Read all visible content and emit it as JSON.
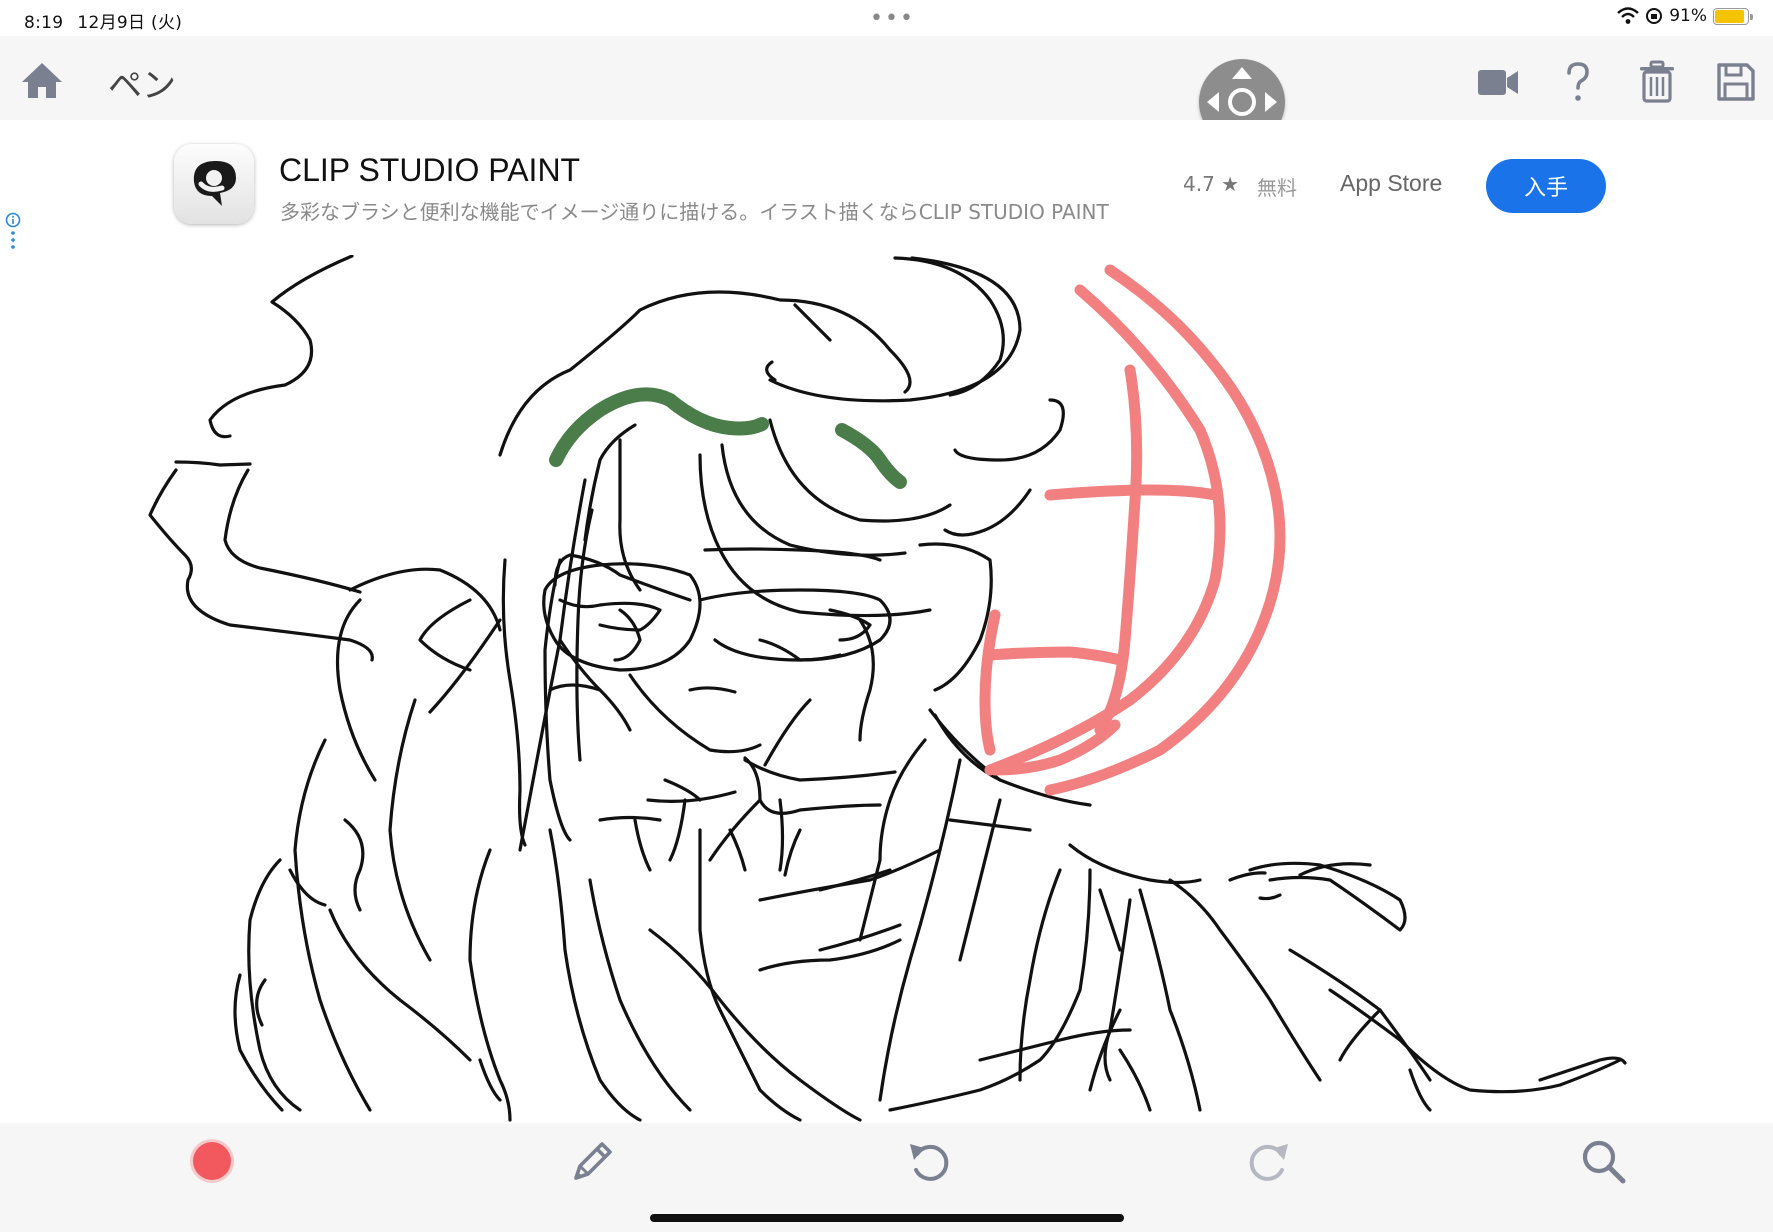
{
  "status": {
    "time": "8:19",
    "date": "12月9日 (火)",
    "multitask": "•••",
    "battery_percent": "91%",
    "battery_level": 0.91
  },
  "toolbar": {
    "title": "ペン",
    "icons": [
      "home-icon",
      "dpad-icon",
      "video-camera-icon",
      "help-icon",
      "trash-icon",
      "save-icon"
    ]
  },
  "ad": {
    "app_name": "CLIP STUDIO PAINT",
    "description": "多彩なブラシと便利な機能でイメージ通りに描ける。イラスト描くならCLIP STUDIO PAINT",
    "rating": "4.7 ★",
    "price": "無料",
    "store": "App Store",
    "get_label": "入手"
  },
  "canvas": {
    "stroke_colors": {
      "ink": "#111111",
      "green": "#4a7d4a",
      "red": "#f28080"
    }
  },
  "bottom_toolbar": {
    "current_color": "#f2595f",
    "icons": [
      "color-dot",
      "pencil-icon",
      "undo-icon",
      "redo-icon",
      "zoom-icon"
    ]
  }
}
